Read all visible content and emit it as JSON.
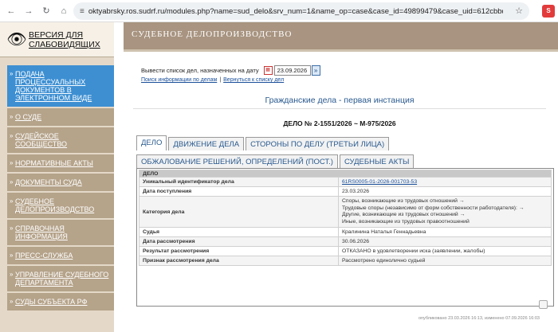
{
  "browser": {
    "url": "oktyabrsky.ros.sudrf.ru/modules.php?name=sud_delo&srv_num=1&name_op=case&case_id=49899479&case_uid=612cbbd5-de04-43b6-..."
  },
  "accessibility": {
    "label": "ВЕРСИЯ ДЛЯ СЛАБОВИДЯЩИХ"
  },
  "menu": [
    {
      "label": "ПОДАЧА ПРОЦЕССУАЛЬНЫХ ДОКУМЕНТОВ В ЭЛЕКТРОННОМ ВИДЕ"
    },
    {
      "label": "О СУДЕ"
    },
    {
      "label": "СУДЕЙСКОЕ СООБЩЕСТВО"
    },
    {
      "label": "НОРМАТИВНЫЕ АКТЫ"
    },
    {
      "label": "ДОКУМЕНТЫ СУДА"
    },
    {
      "label": "СУДЕБНОЕ ДЕЛОПРОИЗВОДСТВО"
    },
    {
      "label": "СПРАВОЧНАЯ ИНФОРМАЦИЯ"
    },
    {
      "label": "ПРЕСС-СЛУЖБА"
    },
    {
      "label": "УПРАВЛЕНИЕ СУДЕБНОГО ДЕПАРТАМЕНТА"
    },
    {
      "label": "СУДЫ СУБЪЕКТА РФ"
    }
  ],
  "header": {
    "title": "СУДЕБНОЕ ДЕЛОПРОИЗВОДСТВО"
  },
  "date_filter": {
    "label": "Вывести список дел, назначенных на дату",
    "value": "23.09.2026",
    "button": "»"
  },
  "links": {
    "search": "Поиск информации по делам",
    "separator": "|",
    "back": "Вернуться к списку дел"
  },
  "section_title": "Гражданские дела - первая инстанция",
  "case_number": "ДЕЛО № 2-1551/2026 ~ М-975/2026",
  "tabs_row1": [
    "ДЕЛО",
    "ДВИЖЕНИЕ ДЕЛА",
    "СТОРОНЫ ПО ДЕЛУ (ТРЕТЬИ ЛИЦА)"
  ],
  "tabs_row2": [
    "ОБЖАЛОВАНИЕ РЕШЕНИЙ, ОПРЕДЕЛЕНИЙ (ПОСТ.)",
    "СУДЕБНЫЕ АКТЫ"
  ],
  "table": {
    "header": "ДЕЛО",
    "uid_label": "Уникальный идентификатор дела",
    "uid_value": "61RS0005-01-2026-001703-53",
    "receipt_label": "Дата поступления",
    "receipt_value": "23.03.2026",
    "category_label": "Категория дела",
    "category_lines": [
      "Споры, возникающие из трудовых отношений →",
      "Трудовые споры (независимо от форм собственности работодателя): →",
      "Другие, возникающие из трудовых отношений →",
      "Иные, возникающие из трудовых правоотношений"
    ],
    "judge_label": "Судья",
    "judge_value": "Кралинина Наталья Геннадьевна",
    "review_date_label": "Дата рассмотрения",
    "review_date_value": "30.06.2026",
    "result_label": "Результат рассмотрения",
    "result_value": "ОТКАЗАНО в удовлетворении иска (заявлении, жалобы)",
    "sign_label": "Признак рассмотрения дела",
    "sign_value": "Рассмотрено единолично судьей"
  },
  "footer": {
    "text": "опубликовано 23.03.2026 16:13, изменено 07.09.2026 16:03"
  }
}
